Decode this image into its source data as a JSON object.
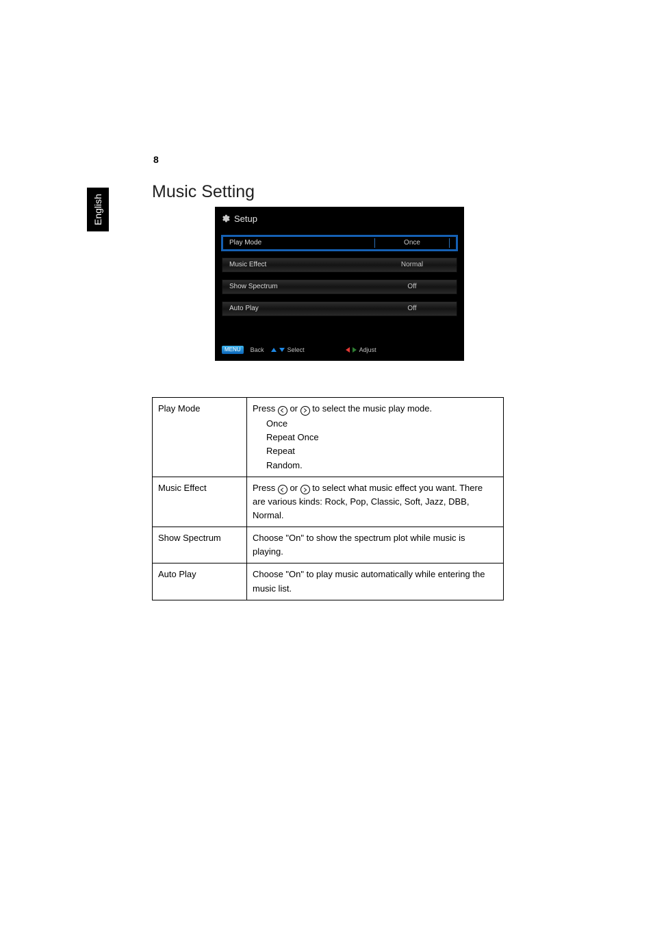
{
  "page_number": "8",
  "language_tab": "English",
  "section_title": "Music Setting",
  "screenshot": {
    "title": "Setup",
    "rows": [
      {
        "label": "Play Mode",
        "value": "Once",
        "selected": true
      },
      {
        "label": "Music Effect",
        "value": "Normal",
        "selected": false
      },
      {
        "label": "Show Spectrum",
        "value": "Off",
        "selected": false
      },
      {
        "label": "Auto Play",
        "value": "Off",
        "selected": false
      }
    ],
    "footer": {
      "button_label": "MENU",
      "back_label": "Back",
      "select_label": "Select",
      "adjust_label": "Adjust"
    }
  },
  "table": {
    "rows": [
      {
        "name": "Play Mode",
        "desc_prefix": "Press ",
        "desc_mid": " or ",
        "desc_suffix": " to select the music play mode.",
        "options": [
          "Once",
          "Repeat Once",
          "Repeat",
          "Random."
        ]
      },
      {
        "name": "Music Effect",
        "desc_prefix": "Press ",
        "desc_mid": " or ",
        "desc_suffix": " to select what music effect you want. There are various kinds: Rock, Pop, Classic, Soft, Jazz, DBB, Normal."
      },
      {
        "name": "Show Spectrum",
        "desc_plain": "Choose \"On\" to show the spectrum plot while music is playing."
      },
      {
        "name": "Auto Play",
        "desc_plain": "Choose \"On\" to play music automatically while entering the music list."
      }
    ]
  }
}
